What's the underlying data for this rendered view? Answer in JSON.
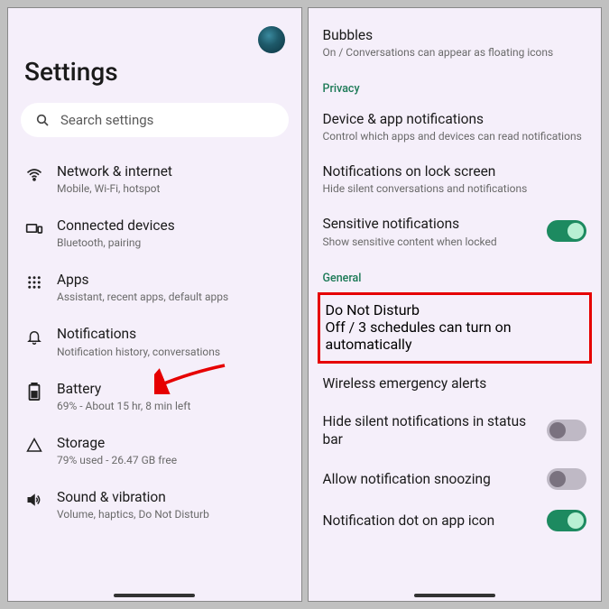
{
  "left": {
    "title": "Settings",
    "search_placeholder": "Search settings",
    "items": [
      {
        "label": "Network & internet",
        "sub": "Mobile, Wi-Fi, hotspot"
      },
      {
        "label": "Connected devices",
        "sub": "Bluetooth, pairing"
      },
      {
        "label": "Apps",
        "sub": "Assistant, recent apps, default apps"
      },
      {
        "label": "Notifications",
        "sub": "Notification history, conversations"
      },
      {
        "label": "Battery",
        "sub": "69% - About 15 hr, 8 min left"
      },
      {
        "label": "Storage",
        "sub": "79% used - 26.47 GB free"
      },
      {
        "label": "Sound & vibration",
        "sub": "Volume, haptics, Do Not Disturb"
      }
    ]
  },
  "right": {
    "top": {
      "label": "Bubbles",
      "sub": "On / Conversations can appear as floating icons"
    },
    "privacy_section": "Privacy",
    "privacy_items": [
      {
        "label": "Device & app notifications",
        "sub": "Control which apps and devices can read notifications"
      },
      {
        "label": "Notifications on lock screen",
        "sub": "Hide silent conversations and notifications"
      },
      {
        "label": "Sensitive notifications",
        "sub": "Show sensitive content when locked",
        "toggle": true
      }
    ],
    "general_section": "General",
    "dnd": {
      "label": "Do Not Disturb",
      "sub": "Off / 3 schedules can turn on automatically"
    },
    "general_items": [
      {
        "label": "Wireless emergency alerts"
      },
      {
        "label": "Hide silent notifications in status bar",
        "toggle": false
      },
      {
        "label": "Allow notification snoozing",
        "toggle": false
      },
      {
        "label": "Notification dot on app icon",
        "toggle": true
      }
    ]
  }
}
